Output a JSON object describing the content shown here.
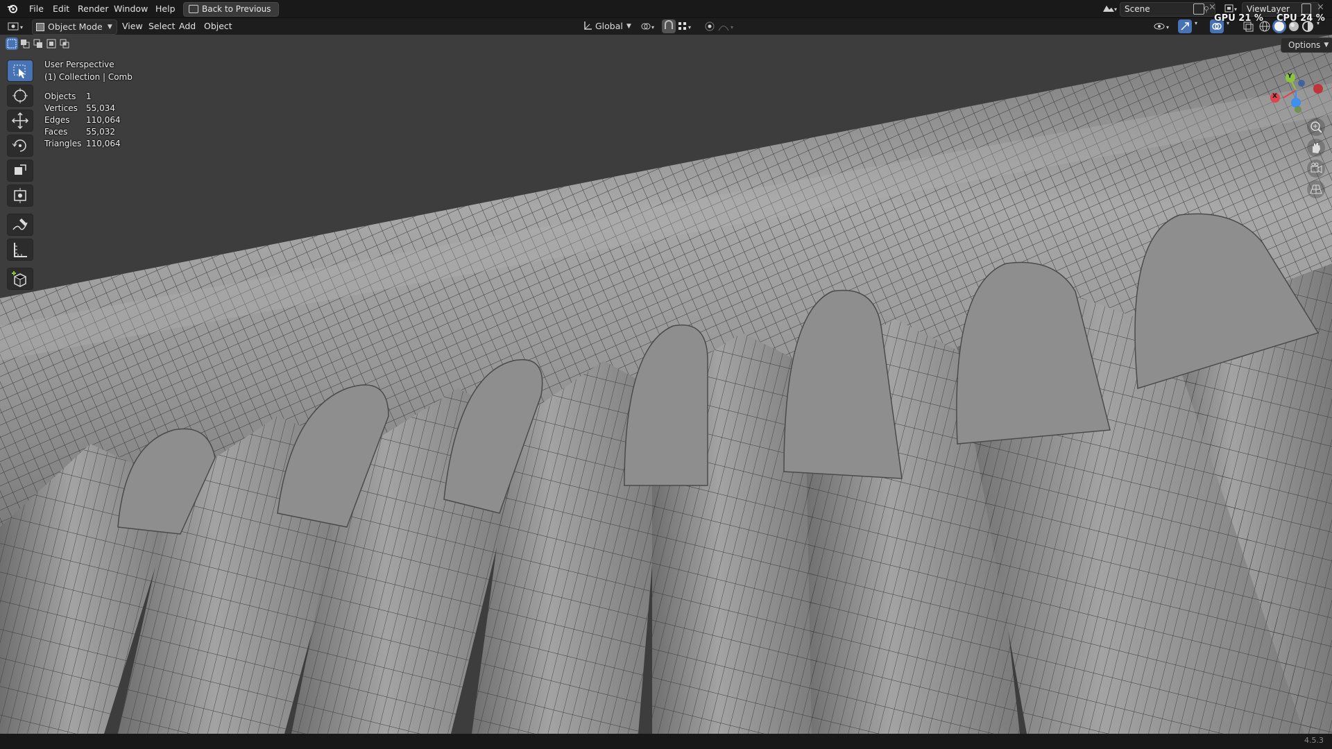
{
  "menu": {
    "items": [
      "File",
      "Edit",
      "Render",
      "Window",
      "Help"
    ],
    "back_label": "Back to Previous"
  },
  "topright": {
    "scene": "Scene",
    "viewlayer": "ViewLayer",
    "gpu_label": "GPU 21 %",
    "cpu_label": "CPU 24 %"
  },
  "header": {
    "mode": "Object Mode",
    "menus": [
      "View",
      "Select",
      "Add",
      "Object"
    ],
    "transform": "Global",
    "options": "Options"
  },
  "viewport": {
    "perspective": "User Perspective",
    "collection": "(1) Collection | Comb",
    "stats": [
      {
        "label": "Objects",
        "value": "1"
      },
      {
        "label": "Vertices",
        "value": "55,034"
      },
      {
        "label": "Edges",
        "value": "110,064"
      },
      {
        "label": "Faces",
        "value": "55,032"
      },
      {
        "label": "Triangles",
        "value": "110,064"
      }
    ],
    "gizmo_axes": {
      "x": "X",
      "y": "Y"
    }
  },
  "colors": {
    "accent": "#4772b3",
    "mesh": "#9a9a9a",
    "background": "#3d3d3d",
    "axis_x": "#e0434a",
    "axis_y": "#8bc53f",
    "axis_z": "#3d8ff0"
  },
  "tools": [
    "select-box-icon",
    "cursor-icon",
    "move-icon",
    "rotate-icon",
    "scale-icon",
    "transform-icon",
    "annotate-icon",
    "measure-icon",
    "add-cube-icon"
  ],
  "version": "4.5.3"
}
